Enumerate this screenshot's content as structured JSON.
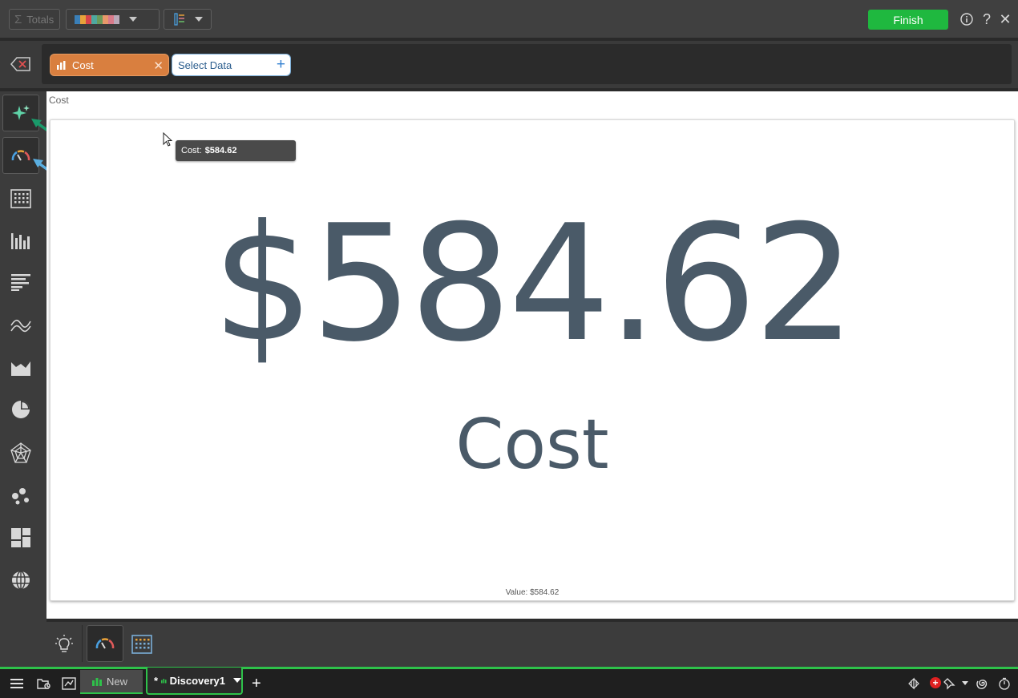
{
  "toolbar": {
    "totals_label": "Totals",
    "palette_colors": [
      "#3a7fb8",
      "#e8a23a",
      "#d8444a",
      "#4fa8a0",
      "#6b9a5a",
      "#e8986a",
      "#d97a8a",
      "#b9a8b8"
    ],
    "finish_label": "Finish",
    "finish_color": "#1fb83f"
  },
  "query": {
    "chips": [
      {
        "label": "Cost",
        "color": "#d97f3f"
      }
    ],
    "select_data_label": "Select Data"
  },
  "sidebar": {
    "items": [
      {
        "name": "auto-viz-icon",
        "selected": true
      },
      {
        "name": "gauge-kpi-icon",
        "selected": true
      },
      {
        "name": "table-grid-icon"
      },
      {
        "name": "column-chart-icon"
      },
      {
        "name": "bar-chart-icon"
      },
      {
        "name": "line-chart-icon"
      },
      {
        "name": "area-chart-icon"
      },
      {
        "name": "pie-chart-icon"
      },
      {
        "name": "radar-chart-icon"
      },
      {
        "name": "scatter-chart-icon"
      },
      {
        "name": "treemap-icon"
      },
      {
        "name": "map-globe-icon"
      }
    ]
  },
  "canvas": {
    "title": "Cost",
    "kpi_value": "$584.62",
    "kpi_label": "Cost",
    "footer": "Value: $584.62",
    "tooltip_key": "Cost:",
    "tooltip_value": "$584.62"
  },
  "tabs": {
    "new_label": "New",
    "active_prefix": "*",
    "active_label": "Discovery1"
  },
  "accent_colors": {
    "green": "#2ec24a",
    "kpi_text": "#4a5a68"
  }
}
